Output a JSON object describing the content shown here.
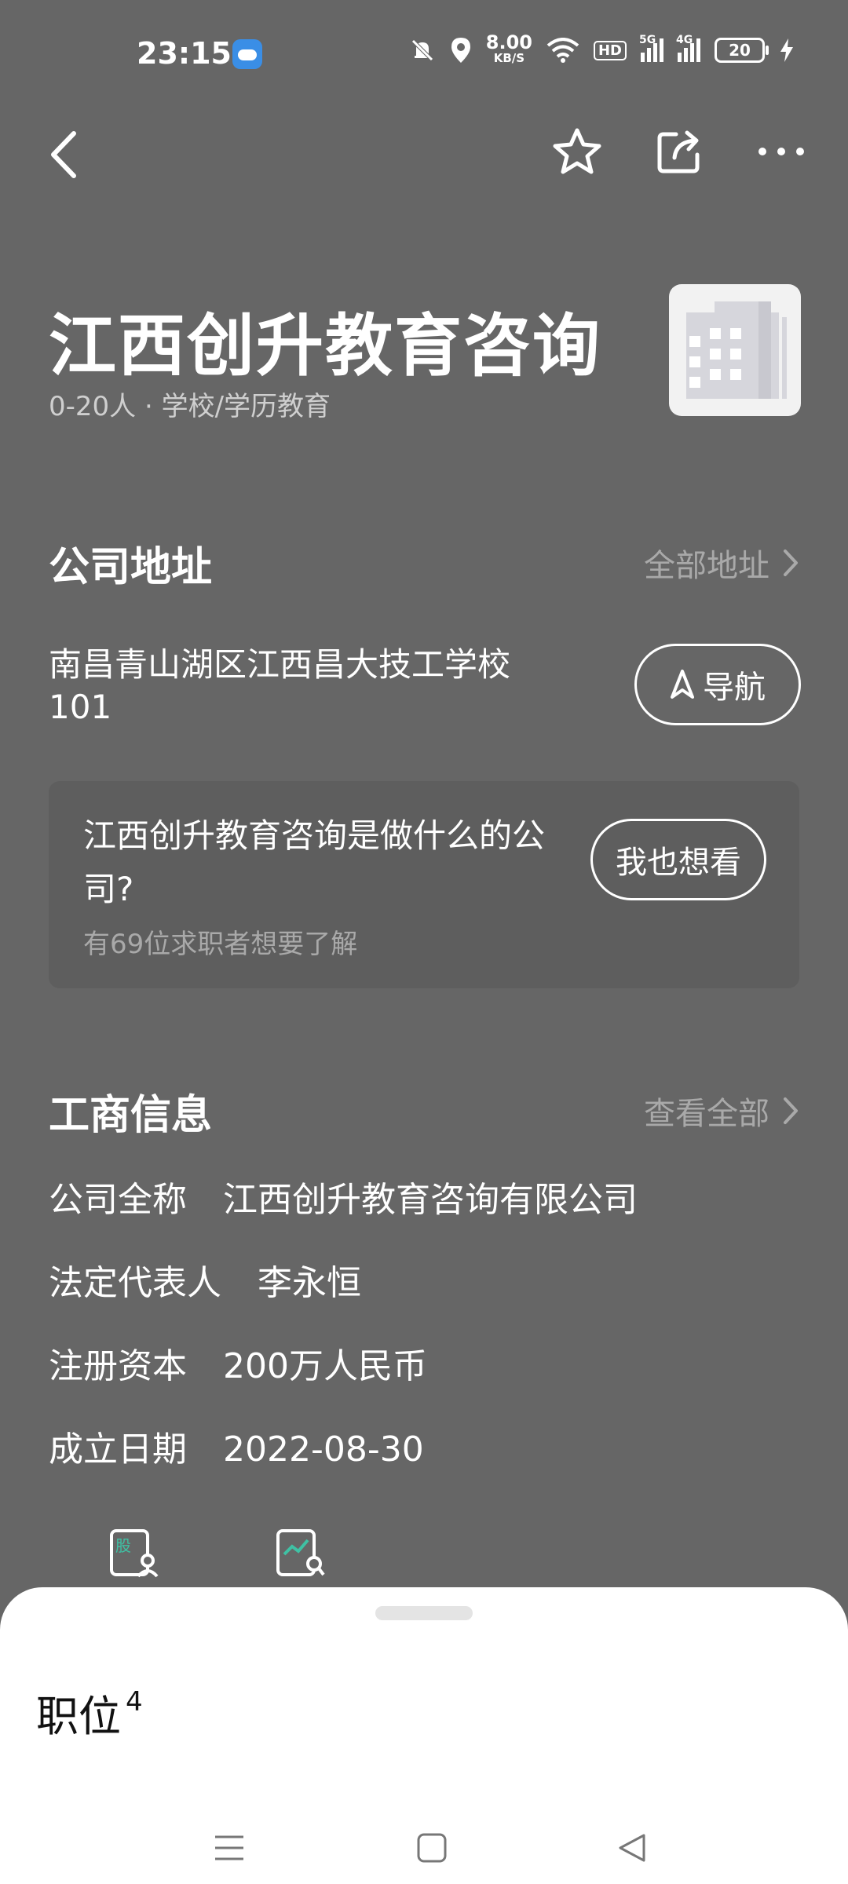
{
  "status_bar": {
    "time": "23:15",
    "net_speed": "8.00",
    "net_unit": "KB/S",
    "hd": "HD",
    "sig1": "5G",
    "sig2": "4G",
    "battery": "20"
  },
  "company": {
    "name": "江西创升教育咨询",
    "meta": "0-20人 · 学校/学历教育"
  },
  "address_section": {
    "title": "公司地址",
    "link": "全部地址",
    "address": "南昌青山湖区江西昌大技工学校101",
    "nav_label": "导航"
  },
  "ask_card": {
    "question": "江西创升教育咨询是做什么的公司?",
    "sub": "有69位求职者想要了解",
    "button": "我也想看"
  },
  "business_section": {
    "title": "工商信息",
    "link": "查看全部",
    "rows": [
      {
        "key": "公司全称",
        "value": "江西创升教育咨询有限公司"
      },
      {
        "key": "法定代表人",
        "value": "李永恒"
      },
      {
        "key": "注册资本",
        "value": "200万人民币"
      },
      {
        "key": "成立日期",
        "value": "2022-08-30"
      }
    ],
    "tool_badge": "股"
  },
  "sheet": {
    "jobs_label": "职位",
    "jobs_count": "4"
  }
}
